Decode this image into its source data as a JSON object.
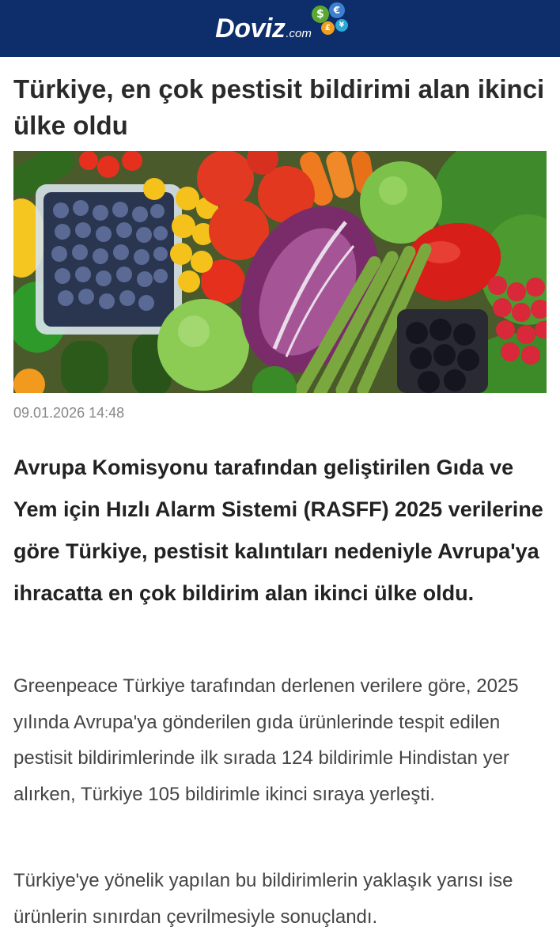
{
  "site": {
    "logo_main": "Doviz",
    "logo_sub": ".com",
    "coin_symbols": [
      "$",
      "€",
      "£",
      "¥"
    ],
    "brand_color": "#0d2d6b"
  },
  "article": {
    "title": "Türkiye, en çok pestisit bildirimi alan ikinci ülke oldu",
    "date": "09.01.2026 14:48",
    "lead": "Avrupa Komisyonu tarafından geliştirilen Gıda ve Yem için Hızlı Alarm Sistemi (RASFF) 2025 verilerine göre Türkiye, pestisit kalıntıları nedeniyle Avrupa'ya ihracatta en çok bildirim alan ikinci ülke oldu.",
    "paragraphs": [
      "Greenpeace Türkiye tarafından derlenen verilere göre, 2025 yılında Avrupa'ya gönderilen gıda ürünlerinde tespit edilen pestisit bildirimlerinde ilk sırada 124 bildirimle Hindistan yer alırken, Türkiye 105 bildirimle ikinci sıraya yerleşti.",
      "Türkiye'ye yönelik yapılan bu bildirimlerin yaklaşık yarısı ise ürünlerin sınırdan çevrilmesiyle sonuçlandı."
    ]
  }
}
